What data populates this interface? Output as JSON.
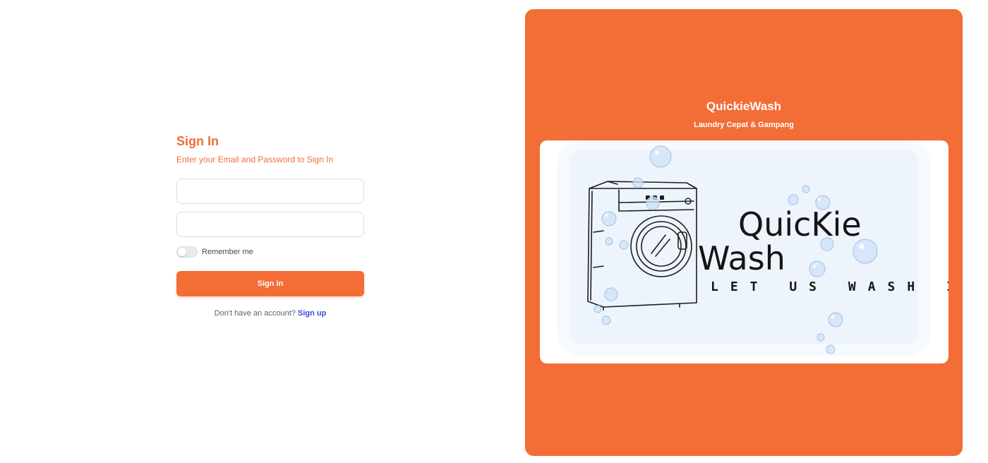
{
  "signin": {
    "title": "Sign In",
    "subtitle": "Enter your Email and Password to Sign In",
    "email_placeholder": "",
    "password_placeholder": "",
    "remember_label": "Remember me",
    "remember_checked": false,
    "button_label": "Sign in",
    "no_account_text": "Don't have an account?",
    "signup_label": "Sign up"
  },
  "brand": {
    "name": "QuickieWash",
    "tagline": "Laundry Cepat & Gampang",
    "logo": {
      "word1": "QuicKie",
      "word2": "Wash",
      "slogan": "LET US WASH IT",
      "icon": "washing-machine-icon"
    }
  },
  "colors": {
    "accent": "#f36d37",
    "link": "#3b49df",
    "panel_text": "#ffffff",
    "logo_bg": "#eef4fc",
    "bubble": "#bcd6f3"
  }
}
